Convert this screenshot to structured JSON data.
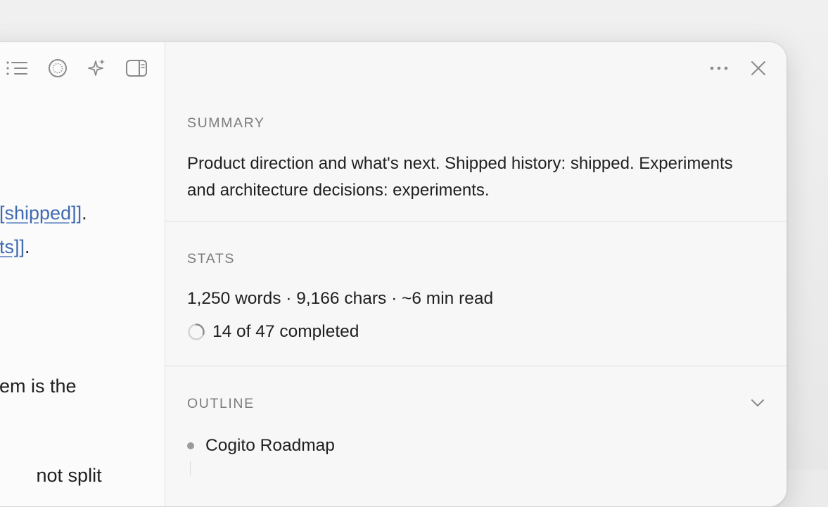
{
  "editor": {
    "toolbar": {
      "outline_icon": "list-icon",
      "focus_icon": "circle-icon",
      "ai_icon": "sparkles-icon",
      "sidebar_icon": "sidebar-right-icon"
    },
    "lines": [
      {
        "before": "",
        "link": "[shipped]]",
        "after": "."
      },
      {
        "before": "",
        "link": "ts]]",
        "after": "."
      },
      {
        "before": "em is the",
        "link": "",
        "after": ""
      },
      {
        "before": " not split",
        "link": "",
        "after": ""
      }
    ]
  },
  "panel": {
    "more_icon": "ellipsis-icon",
    "close_icon": "close-icon",
    "summary": {
      "title": "SUMMARY",
      "text": "Product direction and what's next. Shipped history: shipped. Experiments and architecture decisions: experiments."
    },
    "stats": {
      "title": "STATS",
      "counts": "1,250 words · 9,166 chars · ~6 min read",
      "progress_text": "14 of 47 completed",
      "progress_completed": 14,
      "progress_total": 47
    },
    "outline": {
      "title": "OUTLINE",
      "items": [
        "Cogito Roadmap"
      ]
    }
  },
  "colors": {
    "link": "#3f6ab0",
    "muted": "#7c7c7c",
    "text": "#1f1f1f"
  }
}
